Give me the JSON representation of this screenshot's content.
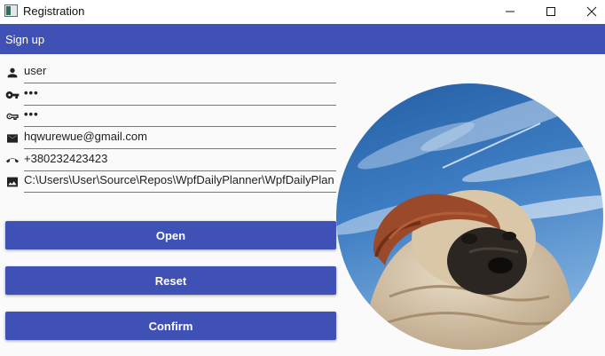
{
  "window": {
    "title": "Registration"
  },
  "appbar": {
    "title": "Sign up"
  },
  "form": {
    "username": "user",
    "password": "•••",
    "confirm_password": "•••",
    "email": "hqwurewue@gmail.com",
    "phone": "+380232423423",
    "image_path": "C:\\Users\\User\\Source\\Repos\\WpfDailyPlanner\\WpfDailyPlan"
  },
  "buttons": {
    "open": "Open",
    "reset": "Reset",
    "confirm": "Confirm"
  },
  "icons": {
    "user": "account-icon",
    "password": "key-icon",
    "confirm_password": "key-variant-icon",
    "email": "email-icon",
    "phone": "phone-icon",
    "image": "image-icon"
  },
  "colors": {
    "primary": "#3f51b5",
    "background": "#fafafa"
  }
}
